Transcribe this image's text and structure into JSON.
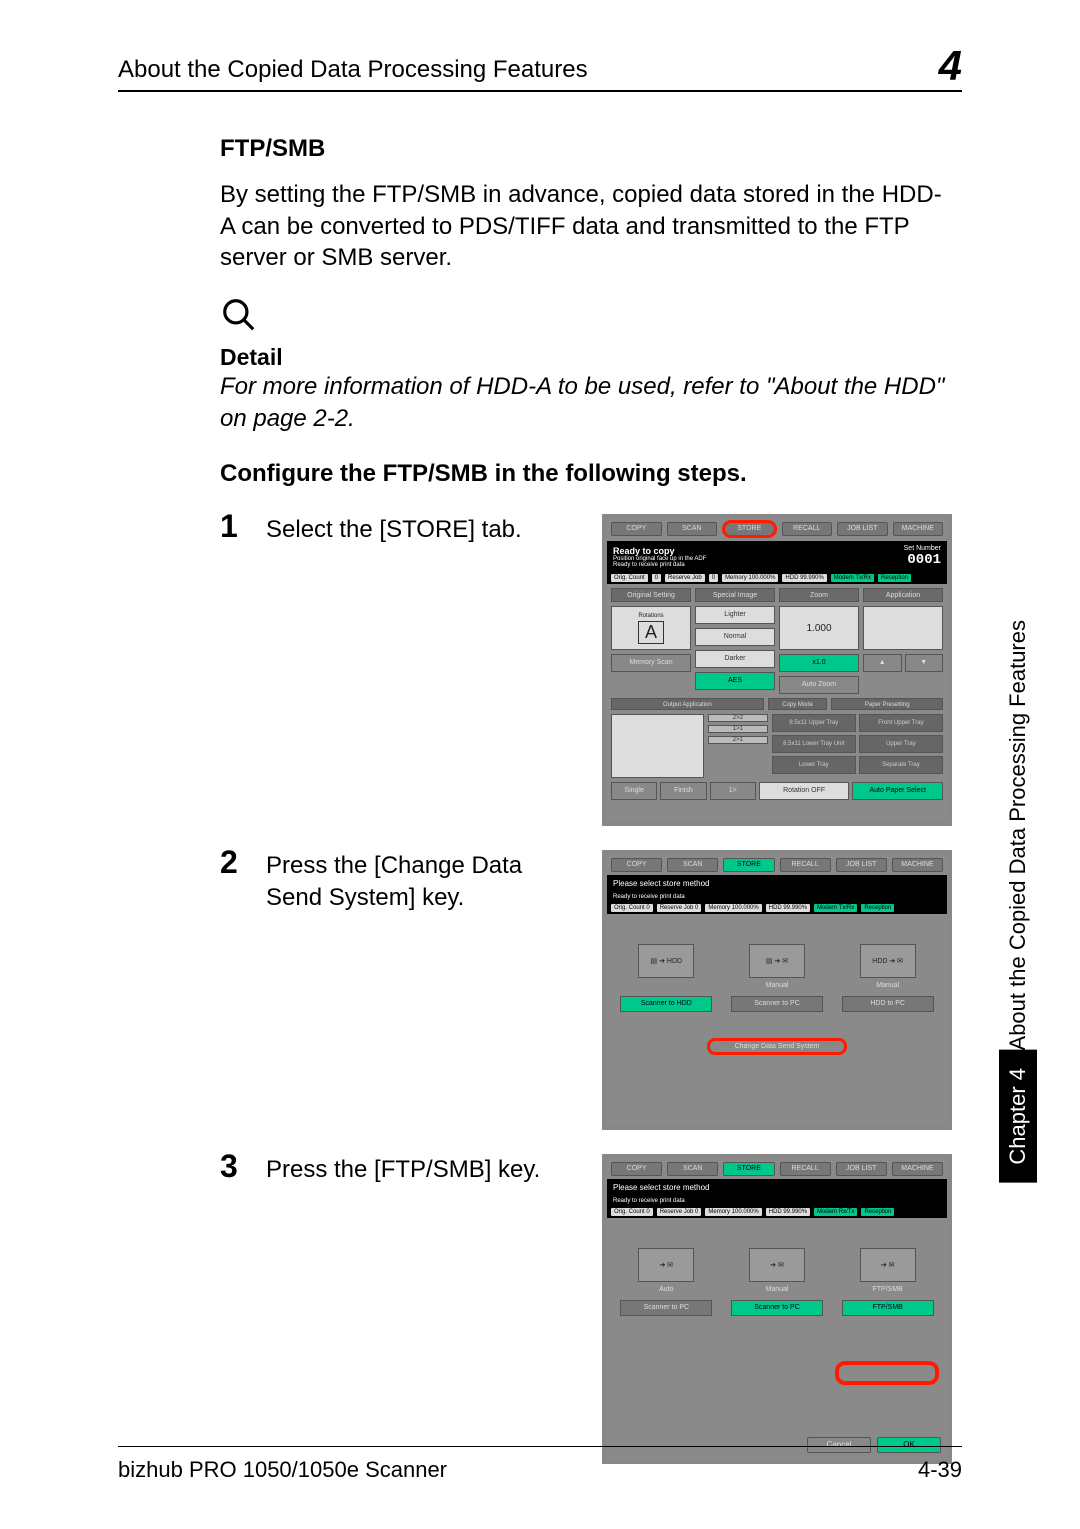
{
  "header": {
    "title": "About the Copied Data Processing Features",
    "chapterNum": "4"
  },
  "sideTab": {
    "black": "Chapter 4",
    "label": "About the Copied Data Processing Features"
  },
  "section": {
    "heading": "FTP/SMB",
    "paragraph": "By setting the FTP/SMB in advance, copied data stored in the HDD-A can be converted to PDS/TIFF data and transmitted to the FTP server or SMB server.",
    "detailHead": "Detail",
    "detailText": "For more information of HDD-A to be used, refer to \"About the HDD\" on page 2-2.",
    "configureHead": "Configure the FTP/SMB in the following steps."
  },
  "steps": [
    {
      "num": "1",
      "text": "Select the [STORE] tab."
    },
    {
      "num": "2",
      "text": "Press the [Change Data Send System] key."
    },
    {
      "num": "3",
      "text": "Press the [FTP/SMB] key."
    }
  ],
  "ss1": {
    "tabs": [
      "COPY",
      "SCAN",
      "STORE",
      "RECALL",
      "JOB LIST",
      "MACHINE"
    ],
    "readyTitle": "Ready to copy",
    "readySub": "Position original face up in the ADF",
    "readySub2": "Ready to receive print data",
    "setNumberLabel": "Set Number",
    "setNumber": "0001",
    "stripe": {
      "origCount": "Orig. Count",
      "origVal": "0",
      "reserve": "Reserve Job",
      "reserveVal": "0",
      "memory": "Memory 100.000%",
      "hdd": "HDD 99.990%",
      "modem": "Modem Tx/Rx",
      "reception": "Reception"
    },
    "colHeads": [
      "Original Setting",
      "Special Image",
      "Zoom",
      "Application"
    ],
    "rotation": "Rotations",
    "rotationVal": "A",
    "zoomVal": "1.000",
    "btns": [
      "Lighter",
      "Normal",
      "Darker",
      "x1.0"
    ],
    "memoryScan": "Memory Scan",
    "aes": "AES",
    "autoZoom": "Auto Zoom",
    "bottomHeads": [
      "Output Application",
      "Copy Mode",
      "Paper Presetting"
    ],
    "copyModes": [
      "2>2",
      "1>1",
      "2>1"
    ],
    "paperItems": [
      "8.5x11 Upper Tray",
      "Front Upper Tray",
      "8.5x11 Lower Tray Unit",
      "Upper Tray",
      "Lower Tray",
      "Separate Tray"
    ],
    "foot": [
      "Single",
      "Finish",
      "1>",
      "Rotation OFF",
      "Auto Paper Select"
    ]
  },
  "ss2": {
    "tabs": [
      "COPY",
      "SCAN",
      "STORE",
      "RECALL",
      "JOB LIST",
      "MACHINE"
    ],
    "msg": "Please select store method",
    "sub": "Ready to receive print data",
    "stripe": {
      "origCount": "Orig. Count 0",
      "reserve": "Reserve Job 0",
      "memory": "Memory 100.000%",
      "hdd": "HDD 99.990%",
      "modem": "Modem Tx/Rx",
      "reception": "Reception"
    },
    "methods": [
      {
        "icon": "▤ ➔ HDD",
        "label": "",
        "btn": "Scanner to HDD"
      },
      {
        "icon": "▤ ➔ ✉",
        "label": "Manual",
        "btn": "Scanner to PC"
      },
      {
        "icon": "HDD ➔ ✉",
        "label": "Manual",
        "btn": "HDD to PC"
      }
    ],
    "centerBtn": "Change Data Send System"
  },
  "ss3": {
    "tabs": [
      "COPY",
      "SCAN",
      "STORE",
      "RECALL",
      "JOB LIST",
      "MACHINE"
    ],
    "msg": "Please select store method",
    "sub": "Ready to receive print data",
    "stripe": {
      "origCount": "Orig. Count 0",
      "reserve": "Reserve Job 0",
      "memory": "Memory 100.000%",
      "hdd": "HDD 99.990%",
      "modem": "Modem Rx/Tx",
      "reception": "Reception"
    },
    "methods": [
      {
        "icon": "➔ ✉",
        "label": "Auto",
        "btn": "Scanner to PC"
      },
      {
        "icon": "➔ ✉",
        "label": "Manual",
        "btn": "Scanner to PC"
      },
      {
        "icon": "➔ ✉",
        "label": "FTP/SMB",
        "btn": "FTP/SMB"
      }
    ],
    "cancel": "Cancel",
    "ok": "OK"
  },
  "footer": {
    "left": "bizhub PRO 1050/1050e Scanner",
    "right": "4-39"
  }
}
